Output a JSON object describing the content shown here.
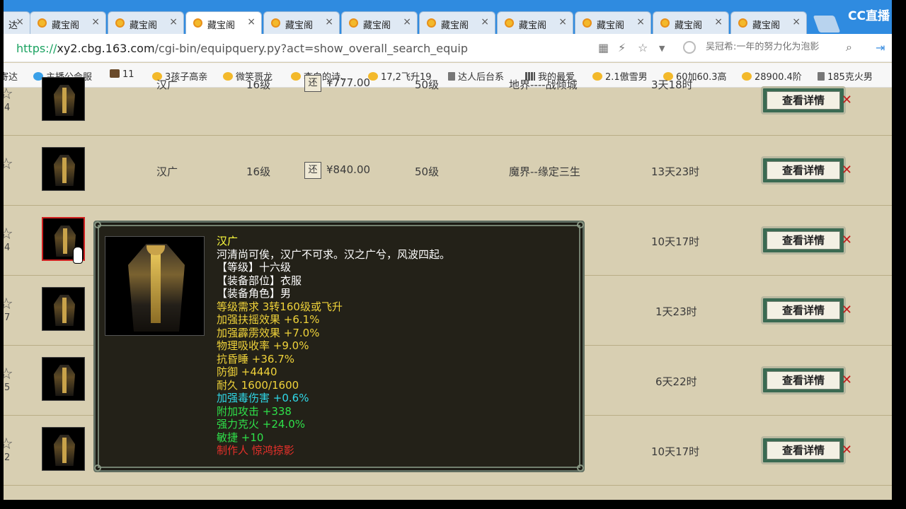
{
  "browser": {
    "tabs": [
      {
        "label": "达"
      },
      {
        "label": "藏宝阁"
      },
      {
        "label": "藏宝阁"
      },
      {
        "label": "藏宝阁"
      },
      {
        "label": "藏宝阁"
      },
      {
        "label": "藏宝阁"
      },
      {
        "label": "藏宝阁"
      },
      {
        "label": "藏宝阁"
      },
      {
        "label": "藏宝阁"
      },
      {
        "label": "藏宝阁"
      },
      {
        "label": "藏宝阁"
      },
      {
        "label": "藏宝阁"
      }
    ],
    "close_glyph": "×",
    "overlay_logo": "CC直播",
    "url": {
      "scheme": "https://",
      "host": "xy2.cbg.163.com",
      "path": "/cgi-bin/equipquery.py?act=show_overall_search_equip"
    },
    "search_placeholder": "吴冠希:一年的努力化为泡影",
    "icons": {
      "qr": "qr-icon",
      "bolt": "lightning-icon",
      "star": "star-icon",
      "dropdown": "chevron-down-icon",
      "search": "search-icon",
      "login": "login-icon"
    },
    "bookmarks": [
      {
        "label": "寄达",
        "icon": "none"
      },
      {
        "label": "主播公会服",
        "icon": "blue"
      },
      {
        "label": "11",
        "icon": "pic"
      },
      {
        "label": "3孩子高亲",
        "icon": "gold"
      },
      {
        "label": "微笑哥龙",
        "icon": "gold"
      },
      {
        "label": "李白的诗、",
        "icon": "gold"
      },
      {
        "label": "17,2飞升19",
        "icon": "gold"
      },
      {
        "label": "达人后台系",
        "icon": "doc"
      },
      {
        "label": "我的最爱",
        "icon": "grid"
      },
      {
        "label": "2.1傲雪男",
        "icon": "gold"
      },
      {
        "label": "60加60.3高",
        "icon": "gold"
      },
      {
        "label": "28900.4阶",
        "icon": "gold"
      },
      {
        "label": "185克火男",
        "icon": "doc"
      }
    ]
  },
  "listing": {
    "rows": [
      {
        "rank": "4",
        "name": "汉广",
        "level": "16级",
        "huan": "还",
        "price": "¥777.00",
        "req": "50级",
        "server": "地界----战倾城",
        "time": "3天18时",
        "detail": "查看详情"
      },
      {
        "rank": "",
        "name": "汉广",
        "level": "16级",
        "huan": "还",
        "price": "¥840.00",
        "req": "50级",
        "server": "魔界--缘定三生",
        "time": "13天23时",
        "detail": "查看详情"
      },
      {
        "rank": "4",
        "name": "",
        "level": "",
        "huan": "",
        "price": "",
        "req": "",
        "server": "",
        "time": "10天17时",
        "detail": "查看详情"
      },
      {
        "rank": "7",
        "name": "",
        "level": "",
        "huan": "",
        "price": "",
        "req": "",
        "server": "",
        "time": "1天23时",
        "detail": "查看详情"
      },
      {
        "rank": "5",
        "name": "",
        "level": "",
        "huan": "",
        "price": "",
        "req": "",
        "server": "",
        "time": "6天22时",
        "detail": "查看详情"
      },
      {
        "rank": "2",
        "name": "",
        "level": "",
        "huan": "",
        "price": "",
        "req": "",
        "server": "",
        "time": "10天17时",
        "detail": "查看详情"
      }
    ]
  },
  "tooltip": {
    "lines": [
      {
        "text": "汉广",
        "color": "yellow"
      },
      {
        "text": "河清尚可俟，汉广不可求。汉之广兮，风波四起。",
        "color": "white"
      },
      {
        "text": "【等级】十六级",
        "color": "white"
      },
      {
        "text": "【装备部位】衣服",
        "color": "white"
      },
      {
        "text": "【装备角色】男",
        "color": "white"
      },
      {
        "text": "等级需求 3转160级或飞升",
        "color": "gold"
      },
      {
        "text": "加强扶摇效果 +6.1%",
        "color": "gold"
      },
      {
        "text": "加强霹雳效果 +7.0%",
        "color": "gold"
      },
      {
        "text": "物理吸收率 +9.0%",
        "color": "gold"
      },
      {
        "text": "抗昏睡 +36.7%",
        "color": "gold"
      },
      {
        "text": "防御 +4440",
        "color": "gold"
      },
      {
        "text": "耐久 1600/1600",
        "color": "gold"
      },
      {
        "text": "加强毒伤害 +0.6%",
        "color": "cyan"
      },
      {
        "text": "附加攻击 +338",
        "color": "green"
      },
      {
        "text": "强力克火 +24.0%",
        "color": "green"
      },
      {
        "text": "敏捷 +10",
        "color": "green"
      },
      {
        "text": "制作人 惊鸿掠影",
        "color": "red"
      }
    ]
  }
}
